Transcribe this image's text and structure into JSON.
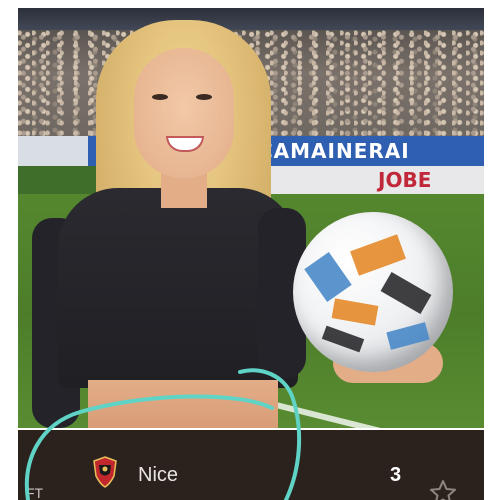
{
  "photo": {
    "ad_board_text": "CAMAINERAI",
    "ad_board_low_text": "JOBE"
  },
  "scoreboard": {
    "status": "FT",
    "team_name": "Nice",
    "score": "3",
    "crest_icon": "ogc-nice-crest-icon",
    "favorite_icon": "star-outline-icon"
  },
  "colors": {
    "scoreboard_bg": "#2c221d",
    "annotation": "#5fd3c6",
    "pitch_green": "#4d7d2a",
    "ad_blue": "#2f5fb0",
    "ad_red": "#c0283a"
  }
}
